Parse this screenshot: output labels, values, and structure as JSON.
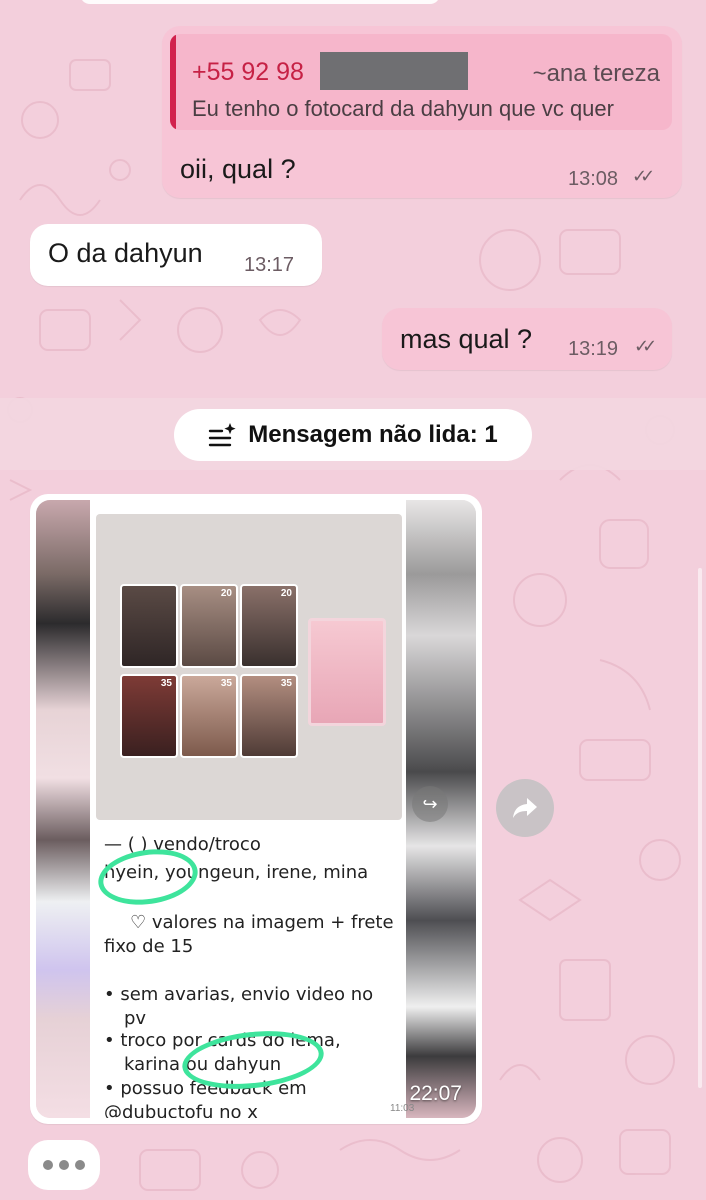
{
  "messages": {
    "reply": {
      "quote_phone": "+55 92 98",
      "quote_name": "~ana tereza",
      "quote_text": "Eu tenho o fotocard da dahyun que vc quer",
      "text": "oii, qual ?",
      "time": "13:08",
      "status": "read"
    },
    "incoming_1": {
      "text": "O da dahyun",
      "time": "13:17"
    },
    "outgoing_2": {
      "text": "mas qual ?",
      "time": "13:19",
      "status": "read"
    }
  },
  "unread": {
    "label": "Mensagem não lida: 1",
    "icon": "sparkle-list-icon"
  },
  "image_message": {
    "time": "22:07",
    "screenshot_lines": [
      "— (  ) vendo/troco",
      "hyein, youngeun, irene, mina",
      "♡ valores na imagem + frete",
      "fixo de 15",
      "•  sem avarias, envio video no",
      "pv",
      "•  troco por cards do lema,",
      "karina ou dahyun",
      "• possuo feedback em",
      "@dubuctofu no x"
    ],
    "screenshot_time": "11:03",
    "card_numbers": [
      "20",
      "20",
      "35",
      "35",
      "35"
    ]
  },
  "colors": {
    "outgoing": "#f7c5d6",
    "incoming": "#ffffff",
    "quote_accent": "#d1224d",
    "highlight": "#3ee49c"
  }
}
